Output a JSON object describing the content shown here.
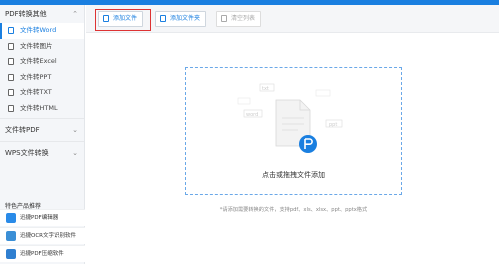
{
  "sidebar": {
    "sections": [
      {
        "label": "PDF转换其他",
        "expanded": true,
        "items": [
          "文件转Word",
          "文件转图片",
          "文件转Excel",
          "文件转PPT",
          "文件转TXT",
          "文件转HTML"
        ]
      },
      {
        "label": "文件转PDF",
        "expanded": false
      },
      {
        "label": "WPS文件转换",
        "expanded": false
      }
    ],
    "promo_title": "特色产品推荐",
    "promo_items": [
      "迅捷PDF编辑器",
      "迅捷OCR文字识别软件",
      "迅捷PDF压缩软件"
    ]
  },
  "toolbar": {
    "add_file": "添加文件",
    "add_folder": "添加文件夹",
    "clear_list": "清空列表"
  },
  "dropzone": {
    "text": "点击或拖拽文件添加",
    "tags": [
      "txt",
      "word",
      "ppt"
    ]
  },
  "hint": "*请添加需要转换的文件，支持pdf、xls、xlsx、ppt、pptx格式",
  "colors": {
    "accent": "#1a7fe0",
    "highlight": "#d33333"
  }
}
